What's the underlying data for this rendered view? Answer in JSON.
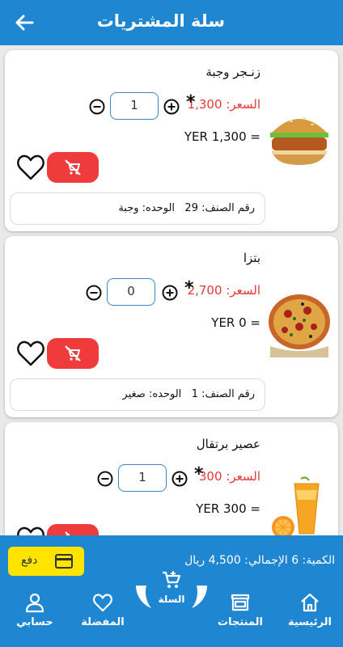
{
  "header": {
    "title": "سلة المشتريات"
  },
  "items": [
    {
      "name": "زنـجر وجبة",
      "price_label": "السعر:",
      "price": "1,300",
      "qty": "1",
      "total": "= YER 1,300",
      "item_no_label": "رقم الصنف:",
      "item_no": "29",
      "unit_label": "الوحده:",
      "unit": "وجبة",
      "image": "burger"
    },
    {
      "name": "بتزا",
      "price_label": "السعر:",
      "price": "2,700",
      "qty": "0",
      "total": "= YER 0",
      "item_no_label": "رقم الصنف:",
      "item_no": "1",
      "unit_label": "الوحده:",
      "unit": "صغير",
      "image": "pizza"
    },
    {
      "name": "عصير برتقال",
      "price_label": "السعر:",
      "price": "300",
      "qty": "1",
      "total": "= YER 300",
      "image": "orange-juice"
    }
  ],
  "summary": {
    "text": "الكمية: 6  الإجمالي: 4,500 ريال"
  },
  "pay_button": {
    "label": "دفع"
  },
  "nav": {
    "home": "الرئيسية",
    "products": "المنتجات",
    "cart": "السلة",
    "favorites": "المفضلة",
    "account": "حسابي"
  },
  "colors": {
    "primary": "#1f86d2",
    "remove": "#ef3b3b",
    "pay": "#ffe400",
    "price": "#e53935"
  }
}
